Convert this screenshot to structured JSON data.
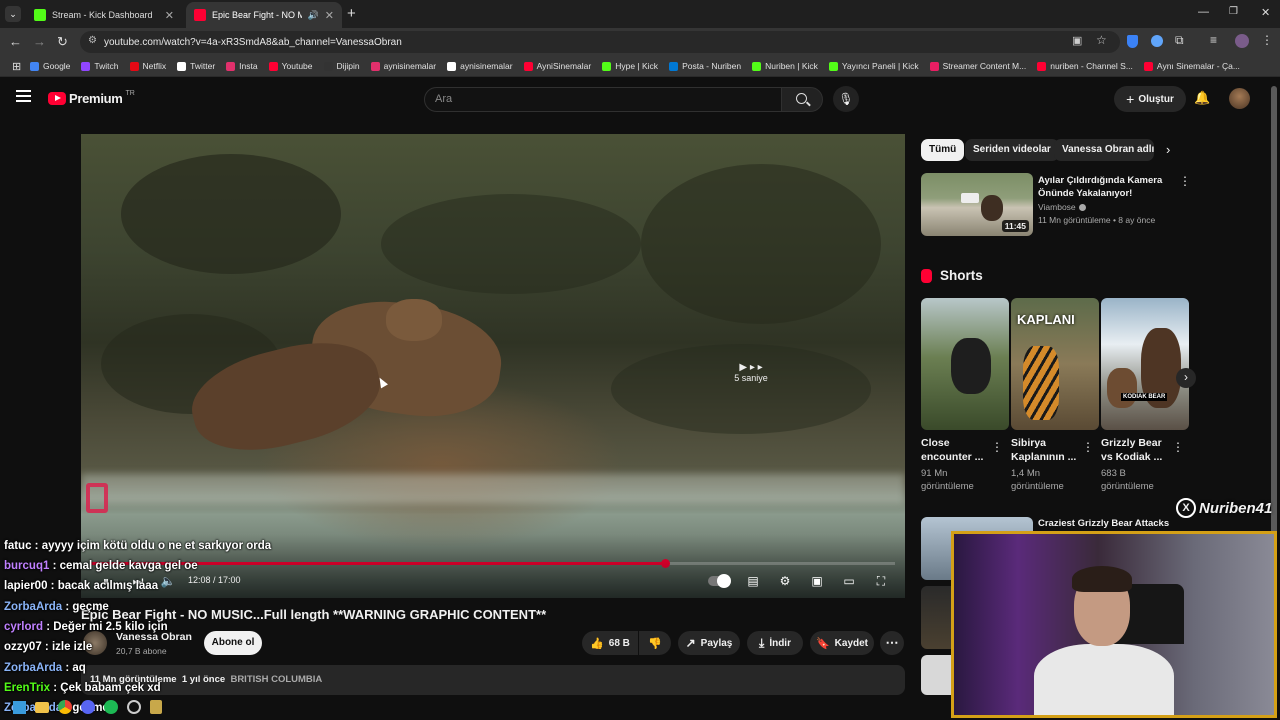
{
  "browser": {
    "tabs": [
      {
        "label": "Stream - Kick Dashboard",
        "color": "#53fc18"
      },
      {
        "label": "Epic Bear Fight - NO MUSIC",
        "color": "#ff0033"
      }
    ],
    "url": "youtube.com/watch?v=4a-xR3SmdA8&ab_channel=VanessaObran",
    "bookmarks": [
      {
        "label": "Google",
        "color": "#4285f4"
      },
      {
        "label": "Twitch",
        "color": "#9146ff"
      },
      {
        "label": "Netflix",
        "color": "#e50914"
      },
      {
        "label": "Twitter",
        "color": "#ffffff"
      },
      {
        "label": "Insta",
        "color": "#e1306c"
      },
      {
        "label": "Youtube",
        "color": "#ff0033"
      },
      {
        "label": "Dijipin",
        "color": "#333333"
      },
      {
        "label": "aynisinemalar",
        "color": "#e1306c"
      },
      {
        "label": "aynisinemalar",
        "color": "#ffffff"
      },
      {
        "label": "AyniSinemalar",
        "color": "#ff0033"
      },
      {
        "label": "Hype | Kick",
        "color": "#53fc18"
      },
      {
        "label": "Posta - Nuriben",
        "color": "#0078d4"
      },
      {
        "label": "Nuriben | Kick",
        "color": "#53fc18"
      },
      {
        "label": "Yayıncı Paneli | Kick",
        "color": "#53fc18"
      },
      {
        "label": "Streamer Content M...",
        "color": "#e91e63"
      },
      {
        "label": "nuriben - Channel S...",
        "color": "#ff0033"
      },
      {
        "label": "Aynı Sinemalar - Ça...",
        "color": "#ff0033"
      }
    ]
  },
  "header": {
    "logo": "Premium",
    "region": "TR",
    "search_placeholder": "Ara",
    "create_label": "Oluştur"
  },
  "player": {
    "time": "12:08 / 17:00",
    "progress": 0.714,
    "skip_label": "5 saniye"
  },
  "video": {
    "title": "Epic Bear Fight - NO MUSIC...Full length **WARNING GRAPHIC CONTENT**",
    "channel": "Vanessa Obran",
    "subscribers": "20,7 B abone",
    "subscribe_label": "Abone ol",
    "likes": "68 B",
    "share_label": "Paylaş",
    "download_label": "İndir",
    "save_label": "Kaydet",
    "views": "11 Mn görüntüleme",
    "age": "1 yıl önce",
    "location": "BRITISH COLUMBIA"
  },
  "sidebar": {
    "chips": [
      "Tümü",
      "Seriden videolar",
      "Vanessa Obran adlı yü"
    ],
    "recommended": [
      {
        "title": "Ayılar Çıldırdığında Kamera Önünde Yakalanıyor!",
        "channel": "Viambose",
        "meta": "11 Mn görüntüleme • 8 ay önce",
        "duration": "11:45"
      },
      {
        "title": "Craziest Grizzly Bear Attacks",
        "channel": "",
        "meta": "",
        "duration": ""
      }
    ],
    "shorts_title": "Shorts",
    "shorts": [
      {
        "title": "Close encounter ...",
        "views": "91 Mn görüntüleme",
        "overlay": ""
      },
      {
        "title": "Sibirya Kaplanının ...",
        "views": "1,4 Mn görüntüleme",
        "overlay": "KAPLANI"
      },
      {
        "title": "Grizzly Bear vs Kodiak ...",
        "views": "683 B görüntüleme",
        "overlay": "KODIAK BEAR"
      }
    ]
  },
  "chat": [
    {
      "user": "fatuc",
      "text": "ayyyy içim kötü oldu o ne et sarkıyor orda",
      "color": "#ffffff"
    },
    {
      "user": "burcuq1",
      "text": "cemal gelde kavga gel oe",
      "color": "#c080ff"
    },
    {
      "user": "lapier00",
      "text": "bacak acılmış laaa",
      "color": "#ffffff"
    },
    {
      "user": "ZorbaArda",
      "text": "geçme",
      "color": "#8ab4f8"
    },
    {
      "user": "cyrlord",
      "text": "Değer mi 2.5 kilo için",
      "color": "#c080ff"
    },
    {
      "user": "ozzy07",
      "text": "izle izle",
      "color": "#ffffff"
    },
    {
      "user": "ZorbaArda",
      "text": "aq",
      "color": "#8ab4f8"
    },
    {
      "user": "ErenTrix",
      "text": "Çek babam çek xd",
      "color": "#53fc18"
    },
    {
      "user": "ZorbaArda",
      "text": "geçme",
      "color": "#8ab4f8"
    }
  ],
  "overlay": {
    "watermark": "Nuriben41"
  }
}
